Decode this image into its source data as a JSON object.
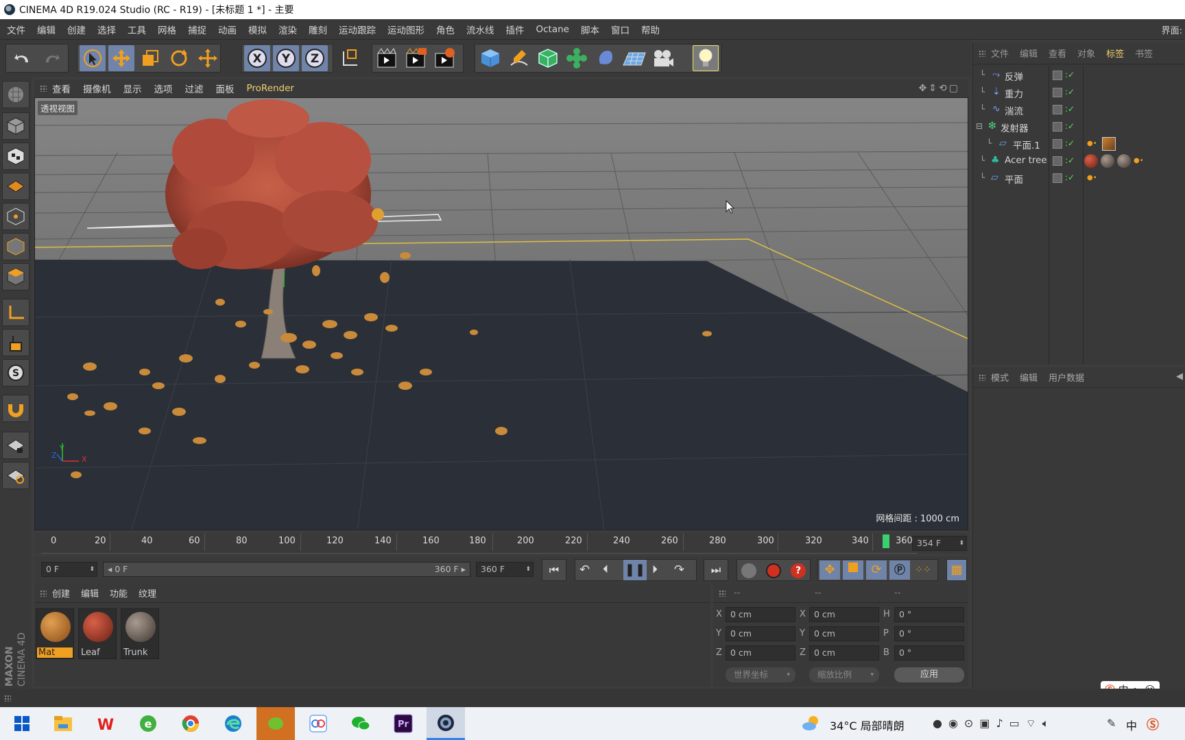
{
  "window": {
    "title": "CINEMA 4D R19.024 Studio (RC - R19) - [未标题 1 *] - 主要",
    "layout_label": "界面:"
  },
  "menu": [
    "文件",
    "编辑",
    "创建",
    "选择",
    "工具",
    "网格",
    "捕捉",
    "动画",
    "模拟",
    "渲染",
    "雕刻",
    "运动跟踪",
    "运动图形",
    "角色",
    "流水线",
    "插件",
    "Octane",
    "脚本",
    "窗口",
    "帮助"
  ],
  "toolbar": {
    "icons": [
      "undo-icon",
      "redo-icon",
      "live-selection-icon",
      "move-icon",
      "scale-icon",
      "rotate-icon",
      "transform-icon",
      "x-axis-icon",
      "y-axis-icon",
      "z-axis-icon",
      "coordinate-system-icon",
      "render-view-icon",
      "render-picture-viewer-icon",
      "render-settings-icon",
      "cube-icon",
      "pen-spline-icon",
      "subdivision-icon",
      "cloner-icon",
      "deformer-icon",
      "floor-icon",
      "camera-icon",
      "light-icon"
    ],
    "axis_labels": [
      "X",
      "Y",
      "Z"
    ]
  },
  "viewport": {
    "menu": [
      "查看",
      "摄像机",
      "显示",
      "选项",
      "过滤",
      "面板",
      "ProRender"
    ],
    "view_label": "透视视图",
    "grid_label": "网格间距 : 1000 cm",
    "axis_labels": {
      "x": "X",
      "y": "Y",
      "z": "Z"
    }
  },
  "timeline": {
    "ticks": [
      "0",
      "20",
      "40",
      "60",
      "80",
      "100",
      "120",
      "140",
      "160",
      "180",
      "200",
      "220",
      "240",
      "260",
      "280",
      "300",
      "320",
      "340",
      "360"
    ],
    "current_frame": "354 F",
    "current_fraction": 0.983
  },
  "transport": {
    "start_field": "0 F",
    "range_start": "◂ 0 F",
    "range_end": "360 F ▸",
    "end_field": "360 F"
  },
  "materials": {
    "menu": [
      "创建",
      "编辑",
      "功能",
      "纹理"
    ],
    "items": [
      {
        "label": "Mat",
        "color": "#c9822e"
      },
      {
        "label": "Leaf",
        "color": "#b4422f"
      },
      {
        "label": "Trunk",
        "color": "#7a6e66"
      }
    ]
  },
  "coords": {
    "header": [
      "--",
      "--",
      "--"
    ],
    "rows": [
      {
        "a": "X",
        "av": "0 cm",
        "b": "X",
        "bv": "0 cm",
        "c": "H",
        "cv": "0 °"
      },
      {
        "a": "Y",
        "av": "0 cm",
        "b": "Y",
        "bv": "0 cm",
        "c": "P",
        "cv": "0 °"
      },
      {
        "a": "Z",
        "av": "0 cm",
        "b": "Z",
        "bv": "0 cm",
        "c": "B",
        "cv": "0 °"
      }
    ],
    "world_dropdown": "世界坐标",
    "scale_dropdown": "缩放比例",
    "apply_button": "应用"
  },
  "object_manager": {
    "menu": [
      "文件",
      "编辑",
      "查看",
      "对象",
      "标签",
      "书签"
    ],
    "objects": [
      {
        "name": "反弹",
        "icon": "bounce-icon"
      },
      {
        "name": "重力",
        "icon": "gravity-icon"
      },
      {
        "name": "湍流",
        "icon": "turbulence-icon"
      },
      {
        "name": "发射器",
        "icon": "emitter-icon"
      },
      {
        "name": "平面.1",
        "icon": "plane-icon"
      },
      {
        "name": "Acer tree",
        "icon": "tree-icon"
      },
      {
        "name": "平面",
        "icon": "plane-icon"
      }
    ]
  },
  "attributes": {
    "menu": [
      "模式",
      "编辑",
      "用户数据"
    ]
  },
  "brand": {
    "line1": "MAXON",
    "line2": "CINEMA 4D"
  },
  "taskbar": {
    "weather": "34°C  局部晴朗",
    "ime": "中",
    "ime_badge": "中 •, ☺"
  },
  "colors": {
    "accent_orange": "#f0a020",
    "selection_blue": "#6f84a8",
    "grid_yellow": "#e0c040"
  }
}
